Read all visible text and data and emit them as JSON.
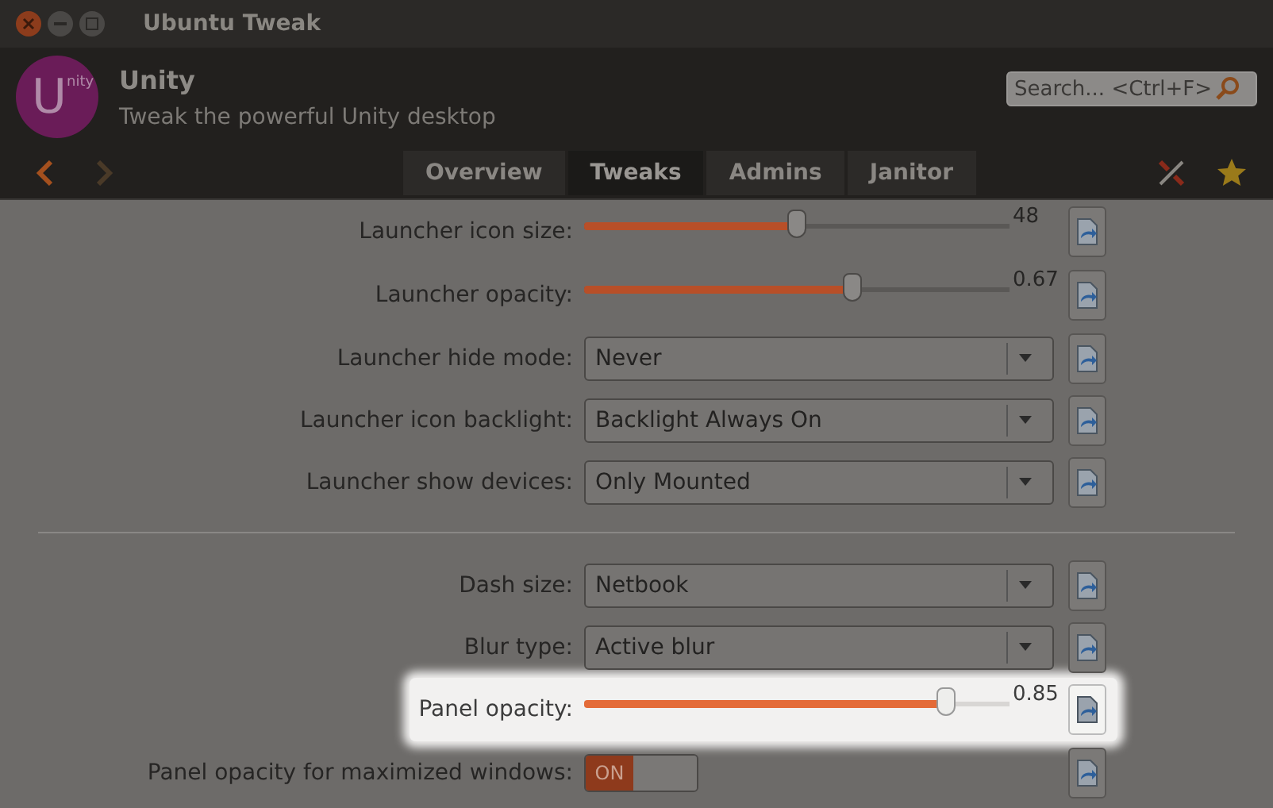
{
  "window": {
    "title": "Ubuntu Tweak"
  },
  "header": {
    "logo": {
      "large": "U",
      "small": "nity"
    },
    "title": "Unity",
    "subtitle": "Tweak the powerful Unity desktop"
  },
  "search": {
    "placeholder": "Search... <Ctrl+F>"
  },
  "tabs": [
    {
      "label": "Overview",
      "selected": false
    },
    {
      "label": "Tweaks",
      "selected": true
    },
    {
      "label": "Admins",
      "selected": false
    },
    {
      "label": "Janitor",
      "selected": false
    }
  ],
  "settings": [
    {
      "kind": "slider",
      "label": "Launcher icon size:",
      "level": 0.5,
      "reading": "48",
      "highlighted": false
    },
    {
      "kind": "slider",
      "label": "Launcher opacity:",
      "level": 0.63,
      "reading": "0.67",
      "highlighted": false
    },
    {
      "kind": "dropdown",
      "label": "Launcher hide mode:",
      "value": "Never",
      "highlighted": false
    },
    {
      "kind": "dropdown",
      "label": "Launcher icon backlight:",
      "value": "Backlight Always On",
      "highlighted": false
    },
    {
      "kind": "dropdown",
      "label": "Launcher show devices:",
      "value": "Only Mounted",
      "highlighted": false
    },
    {
      "kind": "separator"
    },
    {
      "kind": "dropdown",
      "label": "Dash size:",
      "value": "Netbook",
      "highlighted": false
    },
    {
      "kind": "dropdown",
      "label": "Blur type:",
      "value": "Active blur",
      "highlighted": false
    },
    {
      "kind": "slider",
      "label": "Panel opacity:",
      "level": 0.85,
      "reading": "0.85",
      "highlighted": true
    },
    {
      "kind": "switch",
      "label": "Panel opacity for maximized windows:",
      "on": true,
      "on_label": "ON",
      "highlighted": false
    }
  ]
}
